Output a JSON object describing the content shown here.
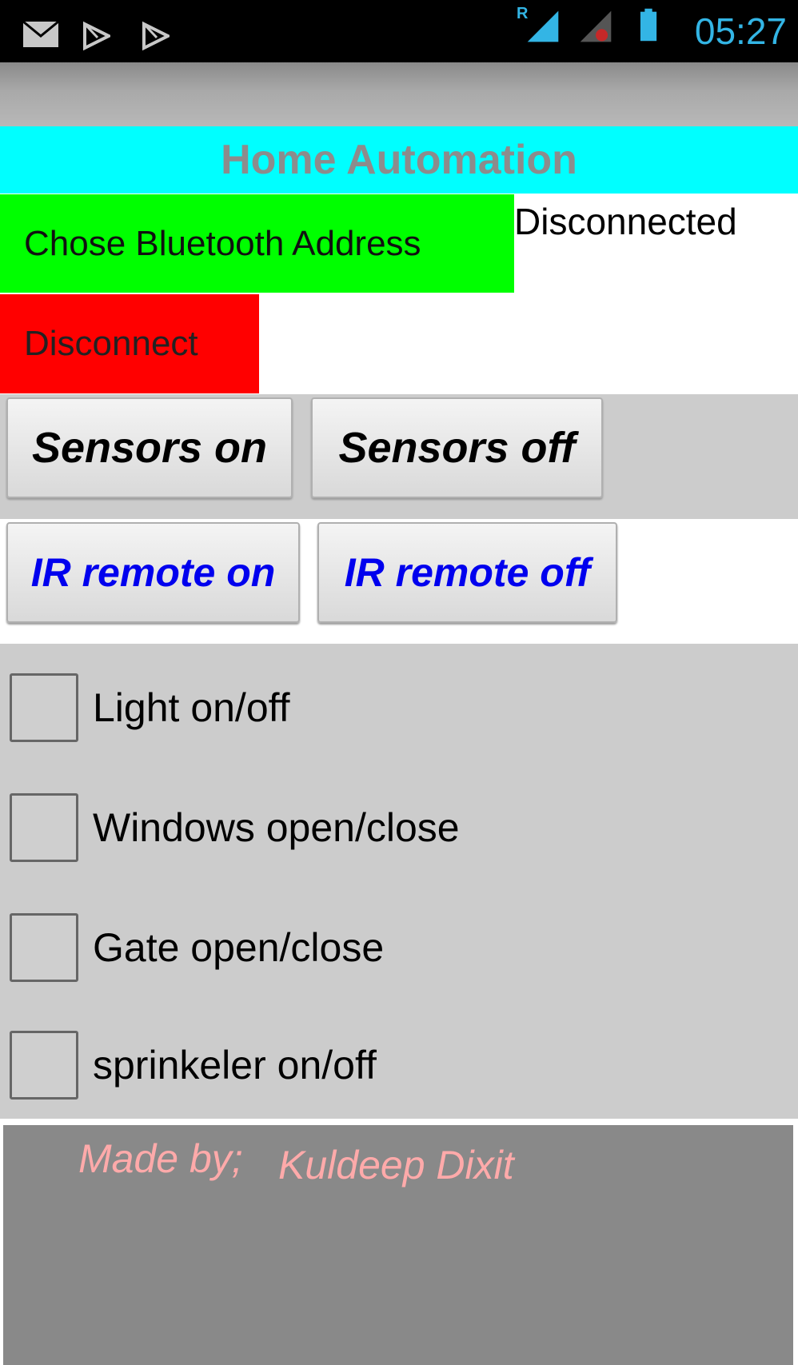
{
  "status_bar": {
    "time": "05:27",
    "roaming_indicator": "R",
    "icons": [
      "mail-icon",
      "play-store-icon",
      "play-store-icon",
      "signal-icon",
      "signal-icon",
      "battery-icon"
    ]
  },
  "header": {
    "title": "Home Automation"
  },
  "bluetooth": {
    "choose_label": "Chose Bluetooth Address",
    "status": "Disconnected",
    "disconnect_label": "Disconnect"
  },
  "sensors": {
    "on_label": "Sensors on",
    "off_label": "Sensors off"
  },
  "ir_remote": {
    "on_label": "IR remote on",
    "off_label": "IR remote off"
  },
  "toggles": [
    {
      "label": "Light on/off",
      "checked": false
    },
    {
      "label": "Windows open/close",
      "checked": false
    },
    {
      "label": "Gate open/close",
      "checked": false
    },
    {
      "label": "sprinkeler on/off",
      "checked": false
    }
  ],
  "footer": {
    "made_by": "Made by;",
    "author": "Kuldeep Dixit"
  },
  "colors": {
    "title_bar": "#00ffff",
    "title_text": "#8c8c8c",
    "bluetooth_button": "#00ff00",
    "disconnect_button": "#ff0000",
    "ir_text": "#0000ee",
    "footer_bg": "#898989",
    "footer_text": "#ffaaaa",
    "clock": "#33b5e5"
  }
}
